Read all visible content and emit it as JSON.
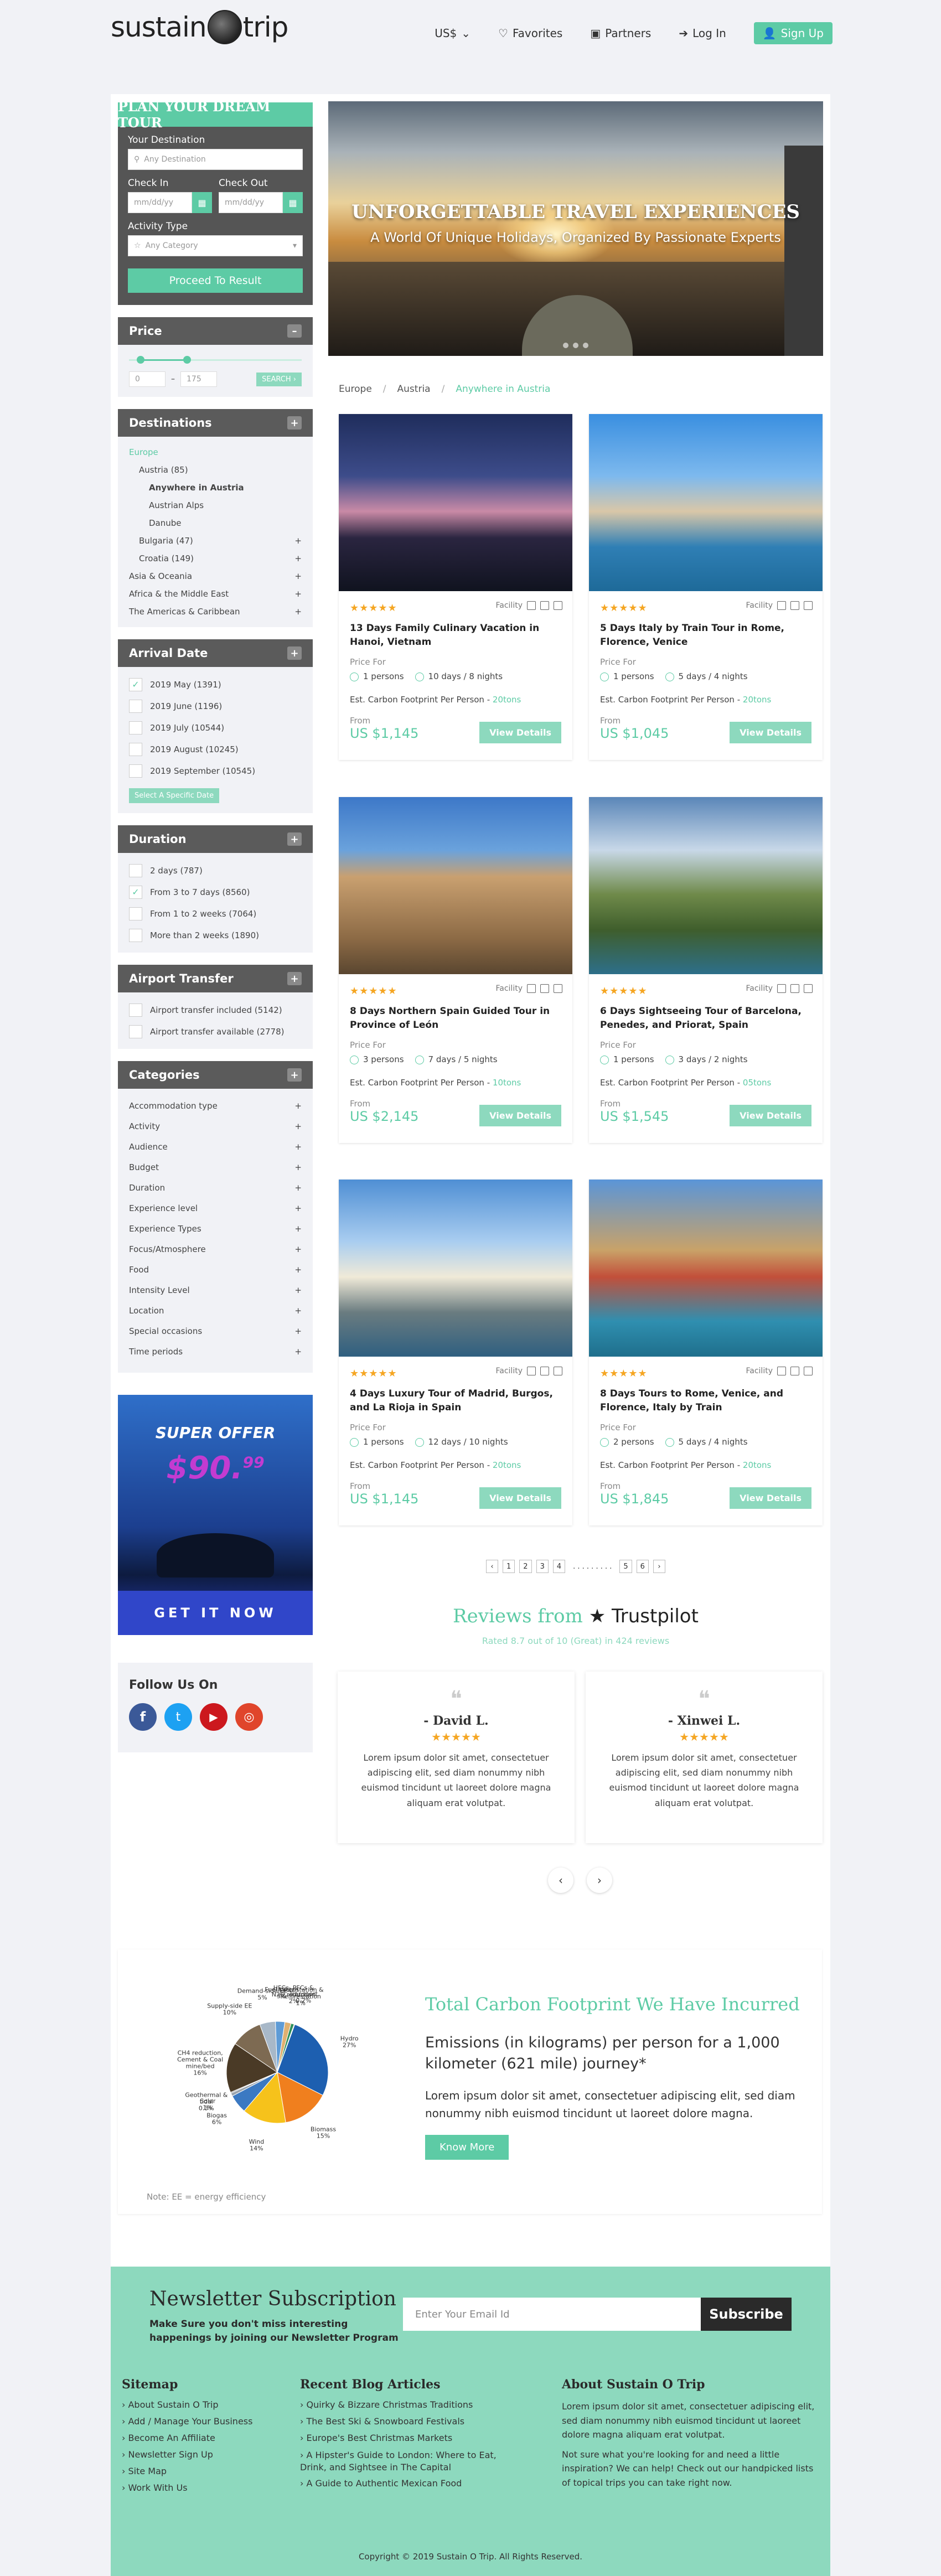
{
  "header": {
    "logo_left": "sustain",
    "logo_right": "trip",
    "currency": "US$",
    "favorites": "Favorites",
    "partners": "Partners",
    "login": "Log In",
    "signup": "Sign Up"
  },
  "search": {
    "title": "PLAN YOUR DREAM TOUR",
    "dest_label": "Your Destination",
    "dest_ph": "Any Destination",
    "checkin_label": "Check In",
    "checkout_label": "Check Out",
    "date_ph": "mm/dd/yy",
    "activity_label": "Activity Type",
    "activity_value": "Any Category",
    "proceed": "Proceed To Result"
  },
  "price": {
    "title": "Price",
    "min": "0",
    "dash": "–",
    "max": "175",
    "search": "SEARCH ›"
  },
  "destinations": {
    "title": "Destinations",
    "items": [
      {
        "label": "Europe",
        "level": 0,
        "plus": ""
      },
      {
        "label": "Austria (85)",
        "level": 1,
        "plus": ""
      },
      {
        "label": "Anywhere in Austria",
        "level": 2,
        "plus": ""
      },
      {
        "label": "Austrian Alps",
        "level": 2,
        "plus": ""
      },
      {
        "label": "Danube",
        "level": 2,
        "plus": ""
      },
      {
        "label": "Bulgaria (47)",
        "level": 1,
        "plus": "+"
      },
      {
        "label": "Croatia (149)",
        "level": 1,
        "plus": "+"
      },
      {
        "label": "Asia & Oceania",
        "level": 0,
        "plus": "+"
      },
      {
        "label": "Africa & the Middle East",
        "level": 0,
        "plus": "+"
      },
      {
        "label": "The Americas & Caribbean",
        "level": 0,
        "plus": "+"
      }
    ]
  },
  "arrival": {
    "title": "Arrival Date",
    "items": [
      "2019 May (1391)",
      "2019 June (1196)",
      "2019 July (10544)",
      "2019 August (10245)",
      "2019 September (10545)"
    ],
    "specific": "Select A Specific Date"
  },
  "duration": {
    "title": "Duration",
    "items": [
      "2 days (787)",
      "From 3 to 7 days (8560)",
      "From 1 to 2 weeks (7064)",
      "More than 2 weeks (1890)"
    ]
  },
  "airport": {
    "title": "Airport Transfer",
    "items": [
      "Airport transfer included (5142)",
      "Airport transfer available (2778)"
    ]
  },
  "categories": {
    "title": "Categories",
    "items": [
      "Accommodation type",
      "Activity",
      "Audience",
      "Budget",
      "Duration",
      "Experience level",
      "Experience Types",
      "Focus/Atmosphere",
      "Food",
      "Intensity Level",
      "Location",
      "Special occasions",
      "Time periods"
    ]
  },
  "offer": {
    "title": "SUPER OFFER",
    "price": "$90.",
    "cents": "99",
    "cta": "GET IT NOW"
  },
  "follow": {
    "title": "Follow Us On"
  },
  "hero": {
    "title": "UNFORGETTABLE TRAVEL EXPERIENCES",
    "subtitle": "A World Of Unique Holidays, Organized By Passionate Experts"
  },
  "breadcrumb": {
    "a": "Europe",
    "b": "Austria",
    "c": "Anywhere in Austria",
    "sep": "/"
  },
  "card_common": {
    "stars": "★★★★★",
    "facility": "Facility",
    "pricefor": "Price For",
    "carbon": "Est. Carbon Footprint Per Person -",
    "from": "From",
    "view": "View Details"
  },
  "tours": [
    {
      "title": "13 Days Family Culinary Vacation in Hanoi, Vietnam",
      "persons": "1 persons",
      "days": "10 days / 8 nights",
      "carbon": "20tons",
      "price": "US $1,145"
    },
    {
      "title": "5 Days Italy by Train Tour in Rome, Florence, Venice",
      "persons": "1 persons",
      "days": "5 days / 4 nights",
      "carbon": "20tons",
      "price": "US $1,045"
    },
    {
      "title": "8 Days Northern Spain Guided Tour in Province of León",
      "persons": "3 persons",
      "days": "7 days / 5 nights",
      "carbon": "10tons",
      "price": "US $2,145"
    },
    {
      "title": "6 Days Sightseeing Tour of Barcelona, Penedes, and Priorat, Spain",
      "persons": "1 persons",
      "days": "3 days / 2 nights",
      "carbon": "05tons",
      "price": "US $1,545"
    },
    {
      "title": "4 Days Luxury Tour of Madrid, Burgos, and La Rioja in Spain",
      "persons": "1 persons",
      "days": "12 days / 10 nights",
      "carbon": "20tons",
      "price": "US $1,145"
    },
    {
      "title": "8 Days Tours to Rome, Venice, and Florence, Italy by Train",
      "persons": "2 persons",
      "days": "5 days / 4 nights",
      "carbon": "20tons",
      "price": "US $1,845"
    }
  ],
  "pager": [
    "‹",
    "1",
    "2",
    "3",
    "4",
    ". . . . . . . . .",
    "5",
    "6",
    "›"
  ],
  "reviews": {
    "title": "Reviews from",
    "brand": "★ Trustpilot",
    "sub": "Rated 8.7 out of 10 (Great) in 424 reviews",
    "items": [
      {
        "name": "- David L.",
        "stars": "★★★★★",
        "text": "Lorem ipsum dolor sit amet, consectetuer adipiscing elit, sed diam nonummy nibh euismod tincidunt ut laoreet dolore magna aliquam erat volutpat."
      },
      {
        "name": "- Xinwei L.",
        "stars": "★★★★★",
        "text": "Lorem ipsum dolor sit amet, consectetuer adipiscing elit, sed diam nonummy nibh euismod tincidunt ut laoreet dolore magna aliquam erat volutpat."
      }
    ],
    "prev": "‹",
    "next": "›"
  },
  "carbon": {
    "title": "Total Carbon Footprint We Have Incurred",
    "subtitle": "Emissions (in kilograms) per person for a 1,000 kilometer (621 mile) journey*",
    "text": "Lorem ipsum dolor sit amet, consectetuer adipiscing elit, sed diam nonummy nibh euismod tincidunt ut laoreet dolore magna.",
    "button": "Know More",
    "note": "Note: EE = energy efficiency"
  },
  "chart_data": {
    "type": "pie",
    "slices": [
      {
        "label": "Hydro",
        "value": 27,
        "color": "#1d5fb0"
      },
      {
        "label": "Biomass",
        "value": 15,
        "color": "#f07f1e"
      },
      {
        "label": "Wind",
        "value": 14,
        "color": "#f6c21b"
      },
      {
        "label": "Biogas",
        "value": 6,
        "color": "#3b79c2"
      },
      {
        "label": "Solar",
        "value": 1,
        "color": "#9aa3ad"
      },
      {
        "label": "Geothermal & tidal",
        "value": 0.3,
        "color": "#6d6d6d"
      },
      {
        "label": "CH4 reduction, Cement & Coal mine/bed",
        "value": 16,
        "color": "#4a3a26"
      },
      {
        "label": "Supply-side EE",
        "value": 10,
        "color": "#7d6a52"
      },
      {
        "label": "Demand-side EE",
        "value": 5,
        "color": "#a8b8c8"
      },
      {
        "label": "Fuel switch",
        "value": 3,
        "color": "#5e9bd6"
      },
      {
        "label": "HFCs, PFCs & N2O reduction",
        "value": 2,
        "color": "#e0b070"
      },
      {
        "label": "Afforestation & Reforestation",
        "value": 1,
        "color": "#2f8f5a"
      },
      {
        "label": "Transport",
        "value": 0.2,
        "color": "#cc3333"
      }
    ],
    "label_texts": [
      "Hydro\n27%",
      "Biomass\n15%",
      "Wind\n14%",
      "Biogas\n6%",
      "Solar\n1%",
      "Geothermal &\ntidal\n0.3%",
      "CH4 reduction,\nCement & Coal\nmine/bed\n16%",
      "Supply-side EE\n10%",
      "Demand-side EE\n5%",
      "Fuel switch\n3%",
      "HFCs, PFCs &\nN2O reduction\n2%",
      "Afforestation &\nReforestation\n1%",
      "Transport\n0.2%"
    ]
  },
  "newsletter": {
    "title": "Newsletter Subscription",
    "sub": "Make Sure you don't miss interesting happenings by joining our Newsletter Program",
    "placeholder": "Enter Your Email Id",
    "button": "Subscribe"
  },
  "footer": {
    "sitemap_title": "Sitemap",
    "sitemap": [
      "About Sustain O Trip",
      "Add / Manage Your Business",
      "Become An Affiliate",
      "Newsletter Sign Up",
      "Site Map",
      "Work With Us"
    ],
    "blog_title": "Recent Blog Articles",
    "blog": [
      "Quirky & Bizzare Christmas Traditions",
      "The Best Ski & Snowboard Festivals",
      "Europe's Best Christmas Markets",
      "A Hipster's Guide to London: Where to Eat, Drink, and Sightsee in The Capital",
      "A Guide to Authentic Mexican Food"
    ],
    "about_title": "About Sustain O Trip",
    "about1": "Lorem ipsum dolor sit amet, consectetuer adipiscing elit, sed diam nonummy nibh euismod tincidunt ut laoreet dolore magna aliquam erat volutpat.",
    "about2": "Not sure what you're looking for and need a little inspiration? We can help! Check out our handpicked lists of topical trips you can take right now.",
    "copyright": "Copyright © 2019 Sustain O Trip. All Rights Reserved."
  }
}
